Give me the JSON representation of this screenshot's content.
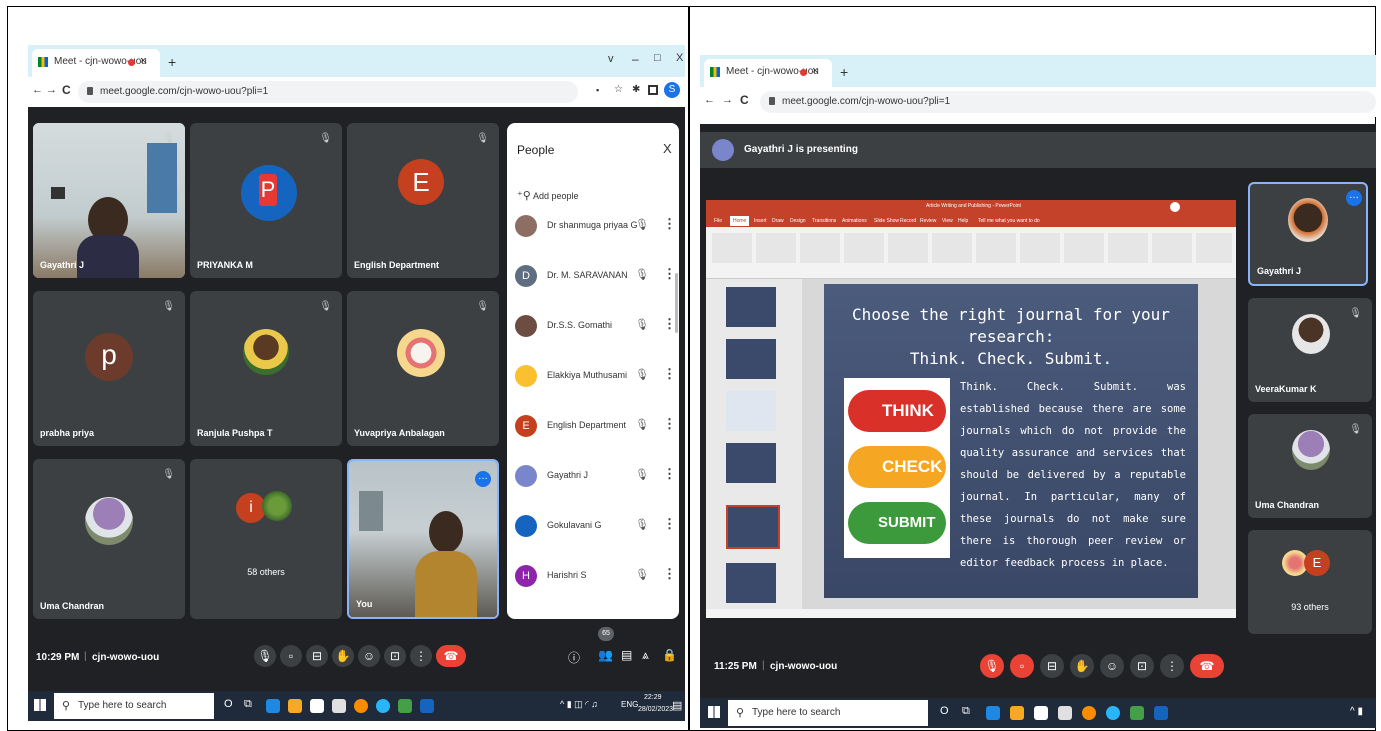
{
  "left": {
    "tab_title": "Meet - cjn-wowo-uou",
    "url": "meet.google.com/cjn-wowo-uou?pli=1",
    "tiles": [
      {
        "name": "Gayathri J"
      },
      {
        "name": "PRIYANKA M",
        "initial": "P"
      },
      {
        "name": "English Department",
        "initial": "E"
      },
      {
        "name": "prabha priya",
        "initial": "p"
      },
      {
        "name": "Ranjula Pushpa T"
      },
      {
        "name": "Yuvapriya Anbalagan"
      },
      {
        "name": "Uma Chandran"
      },
      {
        "name": "58 others",
        "initial": "i"
      },
      {
        "name": "You"
      }
    ],
    "people_panel": {
      "title": "People",
      "add_label": "Add people",
      "list": [
        {
          "name": "Dr shanmuga priyaa G",
          "initial": "",
          "color": "#8d6e63"
        },
        {
          "name": "Dr. M. SARAVANAN",
          "initial": "D",
          "color": "#5f6f81"
        },
        {
          "name": "Dr.S.S. Gomathi",
          "initial": "",
          "color": "#6d4c41"
        },
        {
          "name": "Elakkiya Muthusami",
          "initial": "",
          "color": "#fbc02d"
        },
        {
          "name": "English Department",
          "initial": "E",
          "color": "#c5401f"
        },
        {
          "name": "Gayathri J",
          "initial": "",
          "color": "#7986cb"
        },
        {
          "name": "Gokulavani G",
          "initial": "",
          "color": "#1565c0"
        },
        {
          "name": "Harishri S",
          "initial": "H",
          "color": "#8e24aa"
        }
      ]
    },
    "meeting_time": "10:29 PM",
    "meeting_code": "cjn-wowo-uou",
    "participant_badge": "65",
    "taskbar": {
      "search_placeholder": "Type here to search",
      "lang": "ENG",
      "time": "22:29",
      "date": "28/02/2023"
    }
  },
  "right": {
    "tab_title": "Meet - cjn-wowo-uou",
    "url": "meet.google.com/cjn-wowo-uou?pli=1",
    "presenting_banner": "Gayathri J is presenting",
    "ppt_title": "Article Writing and Publishing - PowerPoint",
    "ppt_tabs": [
      "File",
      "Home",
      "Insert",
      "Draw",
      "Design",
      "Transitions",
      "Animations",
      "Slide Show",
      "Record",
      "Review",
      "View",
      "Help",
      "Tell me what you want to do"
    ],
    "slide": {
      "title_line1": "Choose the right journal for your research:",
      "title_line2": "Think. Check. Submit.",
      "buttons": [
        "THINK",
        "CHECK",
        "SUBMIT"
      ],
      "body": "Think. Check. Submit. was established because there are some journals which do not provide the quality assurance and services that should be delivered by a reputable journal. In particular, many of these journals do not make sure there is thorough peer review or editor feedback process in place."
    },
    "side_tiles": [
      {
        "name": "Gayathri J"
      },
      {
        "name": "VeeraKumar K"
      },
      {
        "name": "Uma Chandran"
      },
      {
        "name": "93 others",
        "initial": "E"
      }
    ],
    "meeting_time": "11:25 PM",
    "meeting_code": "cjn-wowo-uou",
    "taskbar": {
      "search_placeholder": "Type here to search"
    }
  }
}
